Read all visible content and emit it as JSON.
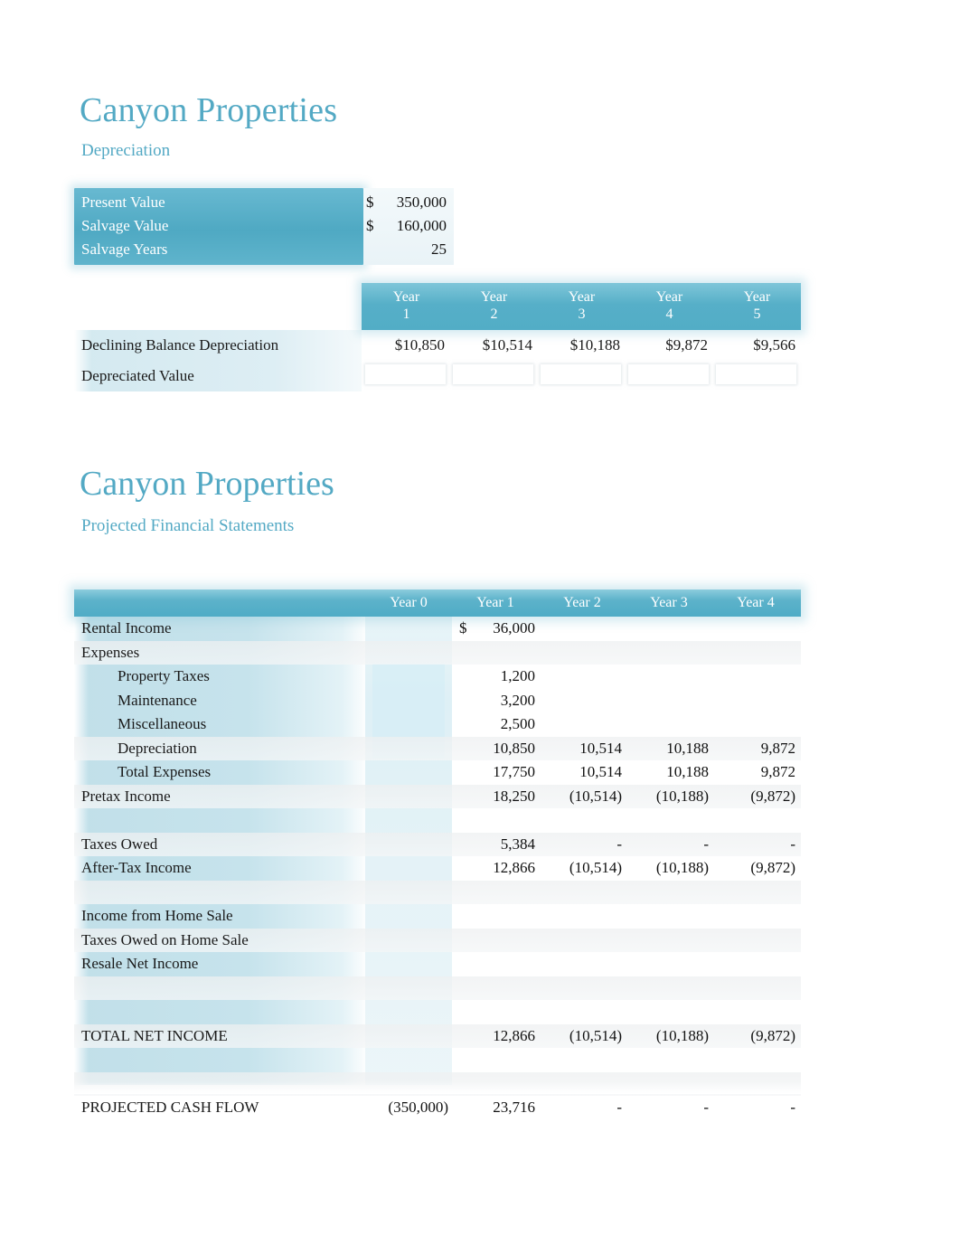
{
  "colors": {
    "accent": "#53A9C4",
    "header_bar": "#52ADC6",
    "input_block": "#4FA9C3",
    "label_tint": "#BEDEE8"
  },
  "section1": {
    "title": "Canyon Properties",
    "subtitle": "Depreciation",
    "inputs": [
      {
        "label": "Present Value",
        "currency": "$",
        "value": "350,000"
      },
      {
        "label": "Salvage Value",
        "currency": "$",
        "value": "160,000"
      },
      {
        "label": "Salvage Years",
        "currency": "",
        "value": "25"
      }
    ],
    "table": {
      "column_headers": [
        {
          "line1": "Year",
          "line2": "1"
        },
        {
          "line1": "Year",
          "line2": "2"
        },
        {
          "line1": "Year",
          "line2": "3"
        },
        {
          "line1": "Year",
          "line2": "4"
        },
        {
          "line1": "Year",
          "line2": "5"
        }
      ],
      "rows": [
        {
          "label": "Declining Balance Depreciation",
          "values": [
            "$10,850",
            "$10,514",
            "$10,188",
            "$9,872",
            "$9,566"
          ]
        },
        {
          "label": "Depreciated Value",
          "values": [
            "",
            "",
            "",
            "",
            ""
          ]
        }
      ]
    }
  },
  "section2": {
    "title": "Canyon Properties",
    "subtitle": "Projected Financial Statements",
    "table": {
      "column_headers": [
        "Year 0",
        "Year 1",
        "Year 2",
        "Year 3",
        "Year 4"
      ],
      "rows": [
        {
          "label": "Rental Income",
          "indent": false,
          "band": false,
          "currency_col": 1,
          "currency": "$",
          "values": [
            "",
            "36,000",
            "",
            "",
            ""
          ]
        },
        {
          "label": "Expenses",
          "indent": false,
          "band": true,
          "values": [
            "",
            "",
            "",
            "",
            ""
          ]
        },
        {
          "label": "Property Taxes",
          "indent": true,
          "band": false,
          "values": [
            "",
            "1,200",
            "",
            "",
            ""
          ]
        },
        {
          "label": "Maintenance",
          "indent": true,
          "band": false,
          "values": [
            "",
            "3,200",
            "",
            "",
            ""
          ]
        },
        {
          "label": "Miscellaneous",
          "indent": true,
          "band": false,
          "values": [
            "",
            "2,500",
            "",
            "",
            ""
          ]
        },
        {
          "label": "Depreciation",
          "indent": true,
          "band": true,
          "values": [
            "",
            "10,850",
            "10,514",
            "10,188",
            "9,872"
          ]
        },
        {
          "label": "Total Expenses",
          "indent": true,
          "band": false,
          "values": [
            "",
            "17,750",
            "10,514",
            "10,188",
            "9,872"
          ]
        },
        {
          "label": "Pretax Income",
          "indent": false,
          "band": true,
          "values": [
            "",
            "18,250",
            "(10,514)",
            "(10,188)",
            "(9,872)"
          ]
        },
        {
          "label": "",
          "indent": false,
          "band": false,
          "values": [
            "",
            "",
            "",
            "",
            ""
          ]
        },
        {
          "label": "Taxes Owed",
          "indent": false,
          "band": true,
          "values": [
            "",
            "5,384",
            "-",
            "-",
            "-"
          ]
        },
        {
          "label": "After-Tax Income",
          "indent": false,
          "band": false,
          "values": [
            "",
            "12,866",
            "(10,514)",
            "(10,188)",
            "(9,872)"
          ]
        },
        {
          "label": "",
          "indent": false,
          "band": true,
          "values": [
            "",
            "",
            "",
            "",
            ""
          ]
        },
        {
          "label": "Income from Home Sale",
          "indent": false,
          "band": false,
          "values": [
            "",
            "",
            "",
            "",
            ""
          ]
        },
        {
          "label": "Taxes Owed on Home Sale",
          "indent": false,
          "band": true,
          "values": [
            "",
            "",
            "",
            "",
            ""
          ]
        },
        {
          "label": "Resale Net Income",
          "indent": false,
          "band": false,
          "values": [
            "",
            "",
            "",
            "",
            ""
          ]
        },
        {
          "label": "",
          "indent": false,
          "band": true,
          "values": [
            "",
            "",
            "",
            "",
            ""
          ]
        },
        {
          "label": "",
          "indent": false,
          "band": false,
          "values": [
            "",
            "",
            "",
            "",
            ""
          ]
        },
        {
          "label": "TOTAL NET INCOME",
          "indent": false,
          "band": true,
          "values": [
            "",
            "12,866",
            "(10,514)",
            "(10,188)",
            "(9,872)"
          ]
        },
        {
          "label": "",
          "indent": false,
          "band": false,
          "values": [
            "",
            "",
            "",
            "",
            ""
          ]
        },
        {
          "label": "",
          "indent": false,
          "band": true,
          "values": [
            "",
            "",
            "",
            "",
            ""
          ]
        },
        {
          "label": "PROJECTED CASH FLOW",
          "indent": false,
          "band": false,
          "values": [
            "(350,000)",
            "23,716",
            "-",
            "-",
            "-"
          ]
        }
      ]
    }
  }
}
